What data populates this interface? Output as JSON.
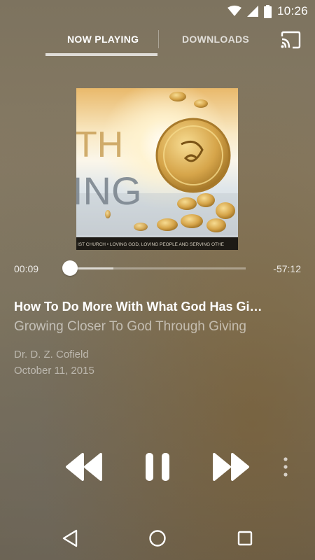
{
  "status_bar": {
    "time": "10:26",
    "icons": [
      "wifi-icon",
      "cell-signal-icon",
      "battery-icon"
    ]
  },
  "tabs": [
    {
      "label": "NOW PLAYING",
      "active": true
    },
    {
      "label": "DOWNLOADS",
      "active": false
    }
  ],
  "cast_icon": "cast-icon",
  "artwork": {
    "caption": "IST CHURCH • LOVING GOD, LOVING PEOPLE AND SERVING OTHE",
    "letters_top": "TH",
    "letters_bottom": "ING"
  },
  "player": {
    "elapsed": "00:09",
    "remaining": "-57:12",
    "progress_fraction": 0.0026,
    "buffered_fraction": 0.25
  },
  "episode": {
    "title": "How To Do More With What God Has Gi…",
    "subtitle": "Growing Closer To God Through Giving",
    "speaker": "Dr. D. Z. Cofield",
    "date": "October 11, 2015"
  },
  "controls": {
    "rewind": "rewind-icon",
    "pause": "pause-icon",
    "forward": "fast-forward-icon",
    "more": "more-vertical-icon"
  },
  "nav_bar": {
    "back": "back-icon",
    "home": "home-icon",
    "recents": "recents-icon"
  },
  "colors": {
    "accent": "#ffffff",
    "background": "#837861"
  }
}
